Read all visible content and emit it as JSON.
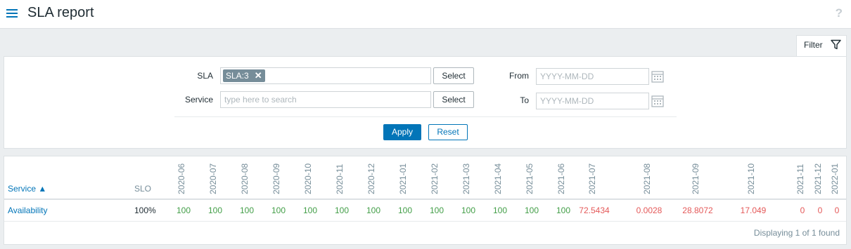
{
  "page": {
    "title": "SLA report"
  },
  "filter": {
    "tab_label": "Filter",
    "sla_label": "SLA",
    "sla_chip": "SLA:3",
    "service_label": "Service",
    "service_placeholder": "type here to search",
    "select_label": "Select",
    "from_label": "From",
    "to_label": "To",
    "date_placeholder": "YYYY-MM-DD",
    "apply_label": "Apply",
    "reset_label": "Reset"
  },
  "table": {
    "service_header": "Service ▲",
    "slo_header": "SLO",
    "periods": [
      "2020-06",
      "2020-07",
      "2020-08",
      "2020-09",
      "2020-10",
      "2020-11",
      "2020-12",
      "2021-01",
      "2021-02",
      "2021-03",
      "2021-04",
      "2021-05",
      "2021-06",
      "2021-07",
      "2021-08",
      "2021-09",
      "2021-10",
      "2021-11",
      "2021-12",
      "2022-01"
    ],
    "rows": [
      {
        "service": "Availability",
        "slo": "100%",
        "values": [
          "100",
          "100",
          "100",
          "100",
          "100",
          "100",
          "100",
          "100",
          "100",
          "100",
          "100",
          "100",
          "100",
          "72.5434",
          "0.0028",
          "28.8072",
          "17.049",
          "0",
          "0",
          "0"
        ],
        "status": [
          "ok",
          "ok",
          "ok",
          "ok",
          "ok",
          "ok",
          "ok",
          "ok",
          "ok",
          "ok",
          "ok",
          "ok",
          "ok",
          "bad",
          "bad",
          "bad",
          "bad",
          "bad",
          "bad",
          "bad"
        ]
      }
    ],
    "footer": "Displaying 1 of 1 found"
  },
  "colors": {
    "ok": "#429e47",
    "bad": "#e45959",
    "accent": "#0275b8"
  }
}
